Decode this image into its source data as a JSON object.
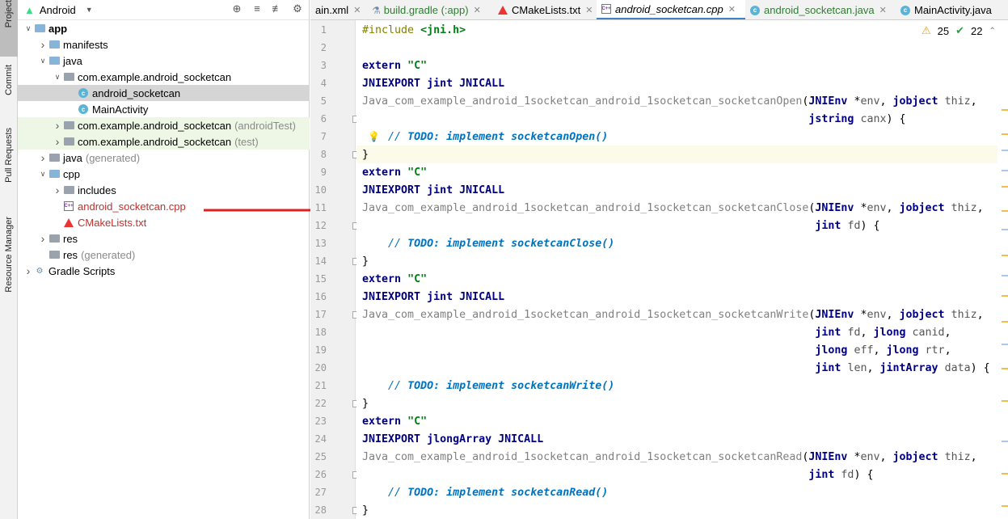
{
  "tool_strip": {
    "buttons": [
      {
        "label": "Project"
      },
      {
        "label": "Commit"
      },
      {
        "label": "Pull Requests"
      },
      {
        "label": "Resource Manager"
      }
    ]
  },
  "project_panel": {
    "view": "Android",
    "tree": [
      {
        "label": "app",
        "hint": "",
        "depth": 0,
        "arrow": "open",
        "icon": "module-folder-icon",
        "style": "bold"
      },
      {
        "label": "manifests",
        "hint": "",
        "depth": 1,
        "arrow": "closed",
        "icon": "folder-icon",
        "style": ""
      },
      {
        "label": "java",
        "hint": "",
        "depth": 1,
        "arrow": "open",
        "icon": "folder-icon",
        "style": ""
      },
      {
        "label": "com.example.android_socketcan",
        "hint": "",
        "depth": 2,
        "arrow": "open",
        "icon": "package-icon",
        "style": ""
      },
      {
        "label": "android_socketcan",
        "hint": "",
        "depth": 3,
        "arrow": "none",
        "icon": "class-icon",
        "style": "selected"
      },
      {
        "label": "MainActivity",
        "hint": "",
        "depth": 3,
        "arrow": "none",
        "icon": "class-icon",
        "style": ""
      },
      {
        "label": "com.example.android_socketcan",
        "hint": "(androidTest)",
        "depth": 2,
        "arrow": "closed",
        "icon": "package-icon",
        "style": "green"
      },
      {
        "label": "com.example.android_socketcan",
        "hint": "(test)",
        "depth": 2,
        "arrow": "closed",
        "icon": "package-icon",
        "style": "green"
      },
      {
        "label": "java",
        "hint": "(generated)",
        "depth": 1,
        "arrow": "closed",
        "icon": "generated-folder-icon",
        "style": ""
      },
      {
        "label": "cpp",
        "hint": "",
        "depth": 1,
        "arrow": "open",
        "icon": "folder-icon",
        "style": ""
      },
      {
        "label": "includes",
        "hint": "",
        "depth": 2,
        "arrow": "closed",
        "icon": "package-icon",
        "style": ""
      },
      {
        "label": "android_socketcan.cpp",
        "hint": "",
        "depth": 2,
        "arrow": "none",
        "icon": "cpp-file-icon",
        "style": "red"
      },
      {
        "label": "CMakeLists.txt",
        "hint": "",
        "depth": 2,
        "arrow": "none",
        "icon": "cmake-icon",
        "style": "red"
      },
      {
        "label": "res",
        "hint": "",
        "depth": 1,
        "arrow": "closed",
        "icon": "res-folder-icon",
        "style": ""
      },
      {
        "label": "res",
        "hint": "(generated)",
        "depth": 1,
        "arrow": "none",
        "icon": "res-folder-icon",
        "style": ""
      },
      {
        "label": "Gradle Scripts",
        "hint": "",
        "depth": 0,
        "arrow": "closed",
        "icon": "gradle-icon",
        "style": ""
      }
    ]
  },
  "tabs": [
    {
      "label": "ain.xml",
      "icon": "",
      "active": false
    },
    {
      "label": "build.gradle (:app)",
      "icon": "gradle-icon",
      "active": false
    },
    {
      "label": "CMakeLists.txt",
      "icon": "cmake-icon",
      "active": false
    },
    {
      "label": "android_socketcan.cpp",
      "icon": "cpp-file-icon",
      "active": true
    },
    {
      "label": "android_socketcan.java",
      "icon": "class-icon",
      "active": false
    },
    {
      "label": "MainActivity.java",
      "icon": "class-icon",
      "active": false
    }
  ],
  "inspections": {
    "warnings": "25",
    "ok": "22"
  },
  "editor": {
    "line_numbers": [
      "1",
      "2",
      "3",
      "4",
      "5",
      "6",
      "7",
      "8",
      "9",
      "10",
      "11",
      "12",
      "13",
      "14",
      "15",
      "16",
      "17",
      "18",
      "19",
      "20",
      "21",
      "22",
      "23",
      "24",
      "25",
      "26",
      "27",
      "28"
    ],
    "lines": [
      "#include <jni.h>",
      "",
      "extern \"C\"",
      "JNIEXPORT jint JNICALL",
      "Java_com_example_android_1socketcan_android_1socketcan_socketcanOpen(JNIEnv *env, jobject thiz,",
      "                                                                     jstring canx) {",
      "    // TODO: implement socketcanOpen()",
      "}",
      "extern \"C\"",
      "JNIEXPORT jint JNICALL",
      "Java_com_example_android_1socketcan_android_1socketcan_socketcanClose(JNIEnv *env, jobject thiz,",
      "                                                                      jint fd) {",
      "    // TODO: implement socketcanClose()",
      "}",
      "extern \"C\"",
      "JNIEXPORT jint JNICALL",
      "Java_com_example_android_1socketcan_android_1socketcan_socketcanWrite(JNIEnv *env, jobject thiz,",
      "                                                                      jint fd, jlong canid,",
      "                                                                      jlong eff, jlong rtr,",
      "                                                                      jint len, jintArray data) {",
      "    // TODO: implement socketcanWrite()",
      "}",
      "extern \"C\"",
      "JNIEXPORT jlongArray JNICALL",
      "Java_com_example_android_1socketcan_android_1socketcan_socketcanRead(JNIEnv *env, jobject thiz,",
      "                                                                     jint fd) {",
      "    // TODO: implement socketcanRead()",
      "}"
    ]
  },
  "colors": {
    "keyword": "#000080",
    "string": "#067d17",
    "todo": "#0073bf",
    "annotation_arrow": "#e02020",
    "selection": "#d5d5d5"
  }
}
